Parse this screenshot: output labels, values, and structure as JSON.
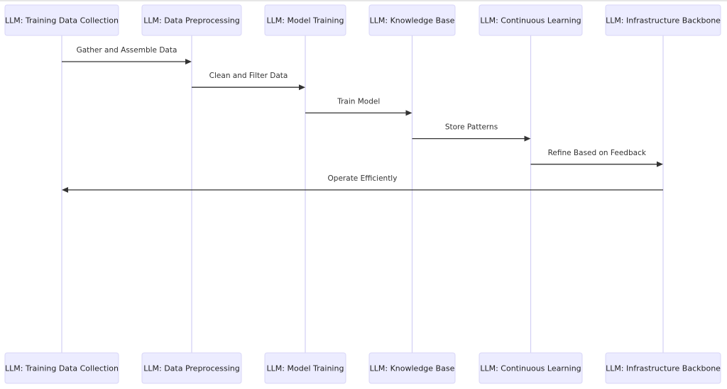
{
  "diagram": {
    "type": "sequence",
    "colors": {
      "actor_fill": "#ECECFF",
      "actor_stroke": "#D9D6F7",
      "lifeline": "#D3CFF5",
      "message_line": "#333333",
      "text": "#222222"
    },
    "participants": [
      {
        "id": "p0",
        "label": "LLM: Training Data Collection"
      },
      {
        "id": "p1",
        "label": "LLM: Data Preprocessing"
      },
      {
        "id": "p2",
        "label": "LLM: Model Training"
      },
      {
        "id": "p3",
        "label": "LLM: Knowledge Base"
      },
      {
        "id": "p4",
        "label": "LLM: Continuous Learning"
      },
      {
        "id": "p5",
        "label": "LLM: Infrastructure Backbone"
      }
    ],
    "messages": [
      {
        "from": 0,
        "to": 1,
        "label": "Gather and Assemble Data"
      },
      {
        "from": 1,
        "to": 2,
        "label": "Clean and Filter Data"
      },
      {
        "from": 2,
        "to": 3,
        "label": "Train Model"
      },
      {
        "from": 3,
        "to": 4,
        "label": "Store Patterns"
      },
      {
        "from": 4,
        "to": 5,
        "label": "Refine Based on Feedback"
      },
      {
        "from": 5,
        "to": 0,
        "label": "Operate Efficiently"
      }
    ]
  }
}
